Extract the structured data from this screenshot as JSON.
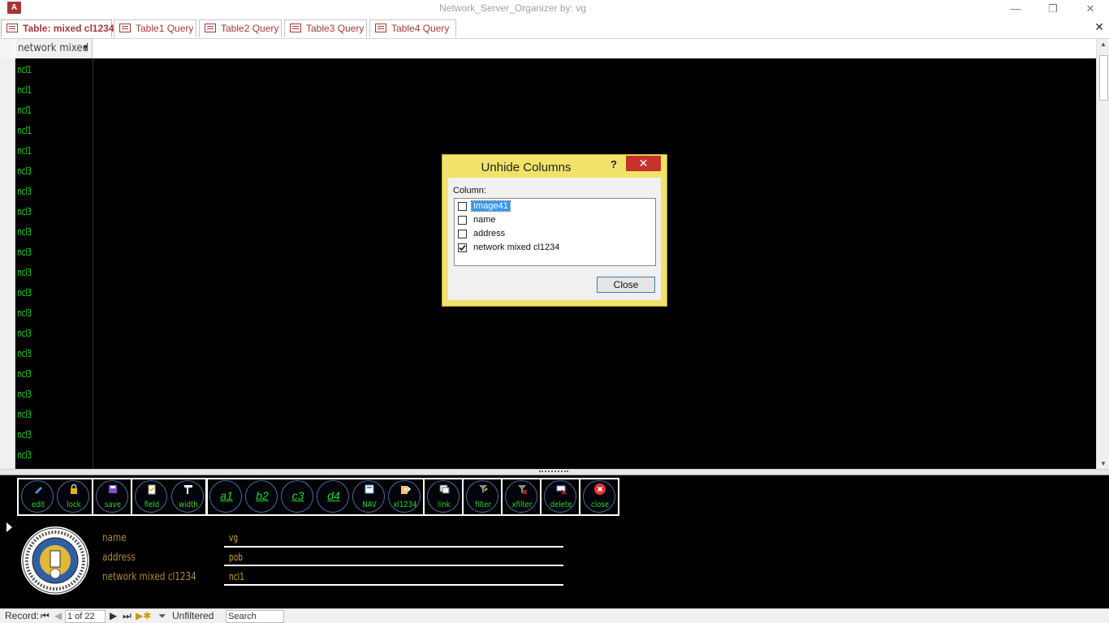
{
  "window": {
    "title": "Network_Server_Organizer by: vg",
    "app_icon": "access-icon",
    "minimize": "—",
    "restore": "❐",
    "close": "✕"
  },
  "tabs": [
    {
      "label": "Table: mixed cl1234",
      "active": true
    },
    {
      "label": "Table1 Query",
      "active": false
    },
    {
      "label": "Table2 Query",
      "active": false
    },
    {
      "label": "Table3 Query",
      "active": false
    },
    {
      "label": "Table4 Query",
      "active": false
    }
  ],
  "tabs_close": "✕",
  "datasheet": {
    "column_header": "network mixed",
    "rows": [
      "ncl1",
      "ncl1",
      "ncl1",
      "ncl1",
      "ncl1",
      "ncl3",
      "ncl3",
      "ncl3",
      "ncl3",
      "ncl3",
      "ncl3",
      "ncl3",
      "ncl3",
      "ncl3",
      "ncl3",
      "ncl3",
      "ncl3",
      "ncl3",
      "ncl3",
      "ncl3"
    ],
    "text_color": "#1fd41f"
  },
  "toolbar": {
    "buttons": [
      {
        "label": "edit",
        "icon": "pencil-icon"
      },
      {
        "label": "lock",
        "icon": "lock-icon"
      },
      {
        "label": "save",
        "icon": "save-icon"
      },
      {
        "label": "field",
        "icon": "clipboard-icon"
      },
      {
        "label": "width",
        "icon": "column-width-icon"
      },
      {
        "label": "a1",
        "icon": ""
      },
      {
        "label": "b2",
        "icon": ""
      },
      {
        "label": "c3",
        "icon": ""
      },
      {
        "label": "d4",
        "icon": ""
      },
      {
        "label": "NAV",
        "icon": "form-icon"
      },
      {
        "label": "xl1234",
        "icon": "export-icon"
      },
      {
        "label": "link",
        "icon": "link-icon"
      },
      {
        "label": "filter",
        "icon": "filter-icon"
      },
      {
        "label": "xfilter",
        "icon": "clear-filter-icon"
      },
      {
        "label": "delete",
        "icon": "delete-icon"
      },
      {
        "label": "close",
        "icon": "close-circle-icon"
      }
    ]
  },
  "form": {
    "fields": [
      {
        "label": "name",
        "value": "vg"
      },
      {
        "label": "address",
        "value": "pob"
      },
      {
        "label": "network mixed cl1234",
        "value": "ncl1"
      }
    ]
  },
  "statusbar": {
    "record_label": "Record:",
    "record_value": "1 of 22",
    "filter_status": "Unfiltered",
    "search_placeholder": "Search"
  },
  "dialog": {
    "title": "Unhide Columns",
    "help": "?",
    "close_x": "✕",
    "column_label": "Column:",
    "items": [
      {
        "label": "Image41",
        "checked": false,
        "selected": true
      },
      {
        "label": "name",
        "checked": false,
        "selected": false
      },
      {
        "label": "address",
        "checked": false,
        "selected": false
      },
      {
        "label": "network mixed cl1234",
        "checked": true,
        "selected": false
      }
    ],
    "close_button": "Close"
  }
}
